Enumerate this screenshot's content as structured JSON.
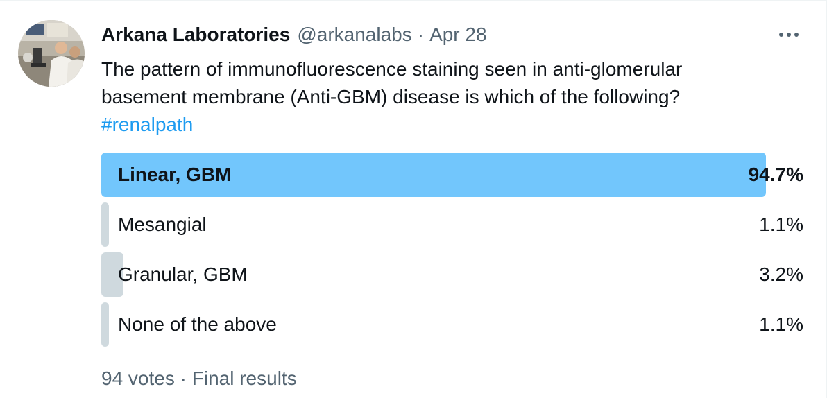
{
  "tweet": {
    "author_name": "Arkana Laboratories",
    "author_handle": "@arkanalabs",
    "separator": "·",
    "date": "Apr 28",
    "more_icon": "more-horizontal-icon",
    "text_line1": "The pattern of immunofluorescence staining seen in anti-glomerular",
    "text_line2": "basement membrane (Anti-GBM) disease is which of the following?",
    "hashtag": "#renalpath"
  },
  "poll": {
    "options": [
      {
        "label": "Linear, GBM",
        "percent_text": "94.7%",
        "percent": 94.7,
        "winner": true
      },
      {
        "label": "Mesangial",
        "percent_text": "1.1%",
        "percent": 1.1,
        "winner": false
      },
      {
        "label": "Granular, GBM",
        "percent_text": "3.2%",
        "percent": 3.2,
        "winner": false
      },
      {
        "label": "None of the above",
        "percent_text": "1.1%",
        "percent": 1.1,
        "winner": false
      }
    ],
    "votes": "94 votes",
    "separator": "·",
    "status": "Final results"
  },
  "colors": {
    "winner_bar": "#72c6fc",
    "other_bar": "#cfd9de",
    "link": "#1d9bf0",
    "secondary_text": "#536471"
  }
}
